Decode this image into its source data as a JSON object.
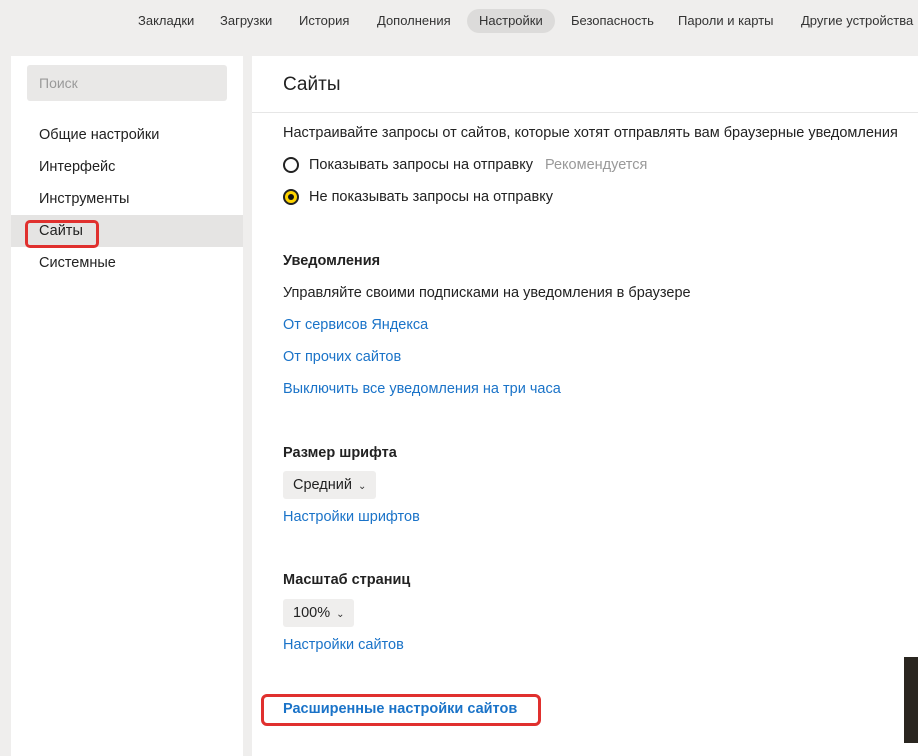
{
  "topnav": {
    "tabs": [
      "Закладки",
      "Загрузки",
      "История",
      "Дополнения",
      "Настройки",
      "Безопасность",
      "Пароли и карты",
      "Другие устройства"
    ],
    "active_index": 4
  },
  "sidebar": {
    "search_placeholder": "Поиск",
    "items": [
      "Общие настройки",
      "Интерфейс",
      "Инструменты",
      "Сайты",
      "Системные"
    ],
    "active_index": 3
  },
  "main": {
    "title": "Сайты",
    "push": {
      "description": "Настраивайте запросы от сайтов, которые хотят отправлять вам браузерные уведомления",
      "option_show": "Показывать запросы на отправку",
      "option_show_hint": "Рекомендуется",
      "option_hide": "Не показывать запросы на отправку",
      "selected": "hide"
    },
    "notifications": {
      "heading": "Уведомления",
      "description": "Управляйте своими подписками на уведомления в браузере",
      "link_yandex": "От сервисов Яндекса",
      "link_other": "От прочих сайтов",
      "link_disable": "Выключить все уведомления на три часа"
    },
    "font": {
      "heading": "Размер шрифта",
      "value": "Средний",
      "link": "Настройки шрифтов"
    },
    "zoom": {
      "heading": "Масштаб страниц",
      "value": "100%",
      "link": "Настройки сайтов"
    },
    "advanced_link": "Расширенные настройки сайтов"
  },
  "colors": {
    "accent_link": "#1a73c8",
    "highlight_red": "#e0302e",
    "radio_checked": "#ffd400"
  }
}
